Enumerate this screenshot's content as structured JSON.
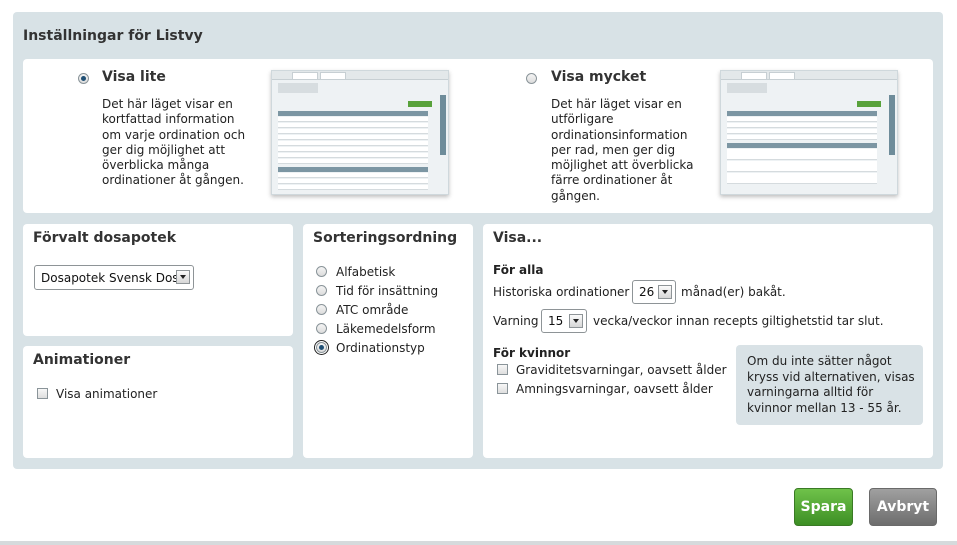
{
  "section_title": "Inställningar för Listvy",
  "list_view": {
    "show_little": {
      "title": "Visa lite",
      "description": "Det här läget visar en kortfattad information om varje ordination och ger dig möjlighet att överblicka många ordinationer åt gången.",
      "selected": true
    },
    "show_much": {
      "title": "Visa mycket",
      "description": "Det här läget visar en utförligare ordinationsinformation per rad, men ger dig möjlighet att överblicka färre ordinationer åt gången.",
      "selected": false
    }
  },
  "default_pharmacy": {
    "title": "Förvalt dosapotek",
    "selected": "Dosapotek Svensk Dos"
  },
  "animations": {
    "title": "Animationer",
    "checkbox_label": "Visa animationer",
    "checked": false
  },
  "sorting": {
    "title": "Sorteringsordning",
    "options": [
      "Alfabetisk",
      "Tid för insättning",
      "ATC område",
      "Läkemedelsform",
      "Ordinationstyp"
    ],
    "selected_index": 4
  },
  "show": {
    "title": "Visa...",
    "for_all": {
      "heading": "För alla",
      "history_prefix": "Historiska ordinationer",
      "history_value": "26",
      "history_suffix": "månad(er) bakåt.",
      "warning_prefix": "Varning",
      "warning_value": "15",
      "warning_suffix": "vecka/veckor innan recepts giltighetstid tar slut."
    },
    "for_women": {
      "heading": "För kvinnor",
      "pregnancy_label": "Graviditetsvarningar, oavsett ålder",
      "breastfeeding_label": "Amningsvarningar, oavsett ålder"
    },
    "note": "Om du inte sätter något kryss vid alternativen, visas varningarna alltid för kvinnor mellan 13 - 55 år."
  },
  "buttons": {
    "save": "Spara",
    "cancel": "Avbryt"
  },
  "colors": {
    "outer_background": "#d8e2e6",
    "save_green": "#4fa22f",
    "cancel_gray": "#808080"
  }
}
